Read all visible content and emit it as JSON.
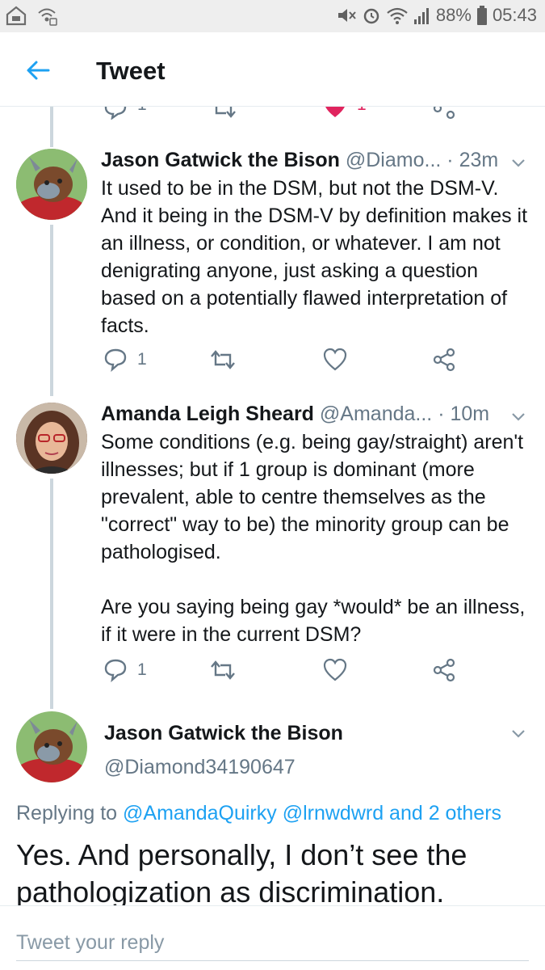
{
  "status_bar": {
    "battery": "88%",
    "time": "05:43"
  },
  "header": {
    "title": "Tweet"
  },
  "colors": {
    "accent": "#1da1f2",
    "secondary_text": "#657786",
    "primary_text": "#14171a",
    "like_red": "#e0245e"
  },
  "partial_row": {
    "reply_count": "1",
    "like_count": "1"
  },
  "tweets": [
    {
      "name": "Jason Gatwick the Bison",
      "handle": "@Diamo...",
      "time": "· 23m",
      "paragraphs": [
        "It used to be in the DSM, but not the DSM-V. And it being in the DSM-V by definition makes it an illness, or condition, or whatever. I am not denigrating anyone, just asking a question based on a potentially flawed interpretation of facts."
      ],
      "reply_count": "1"
    },
    {
      "name": "Amanda Leigh Sheard",
      "handle": "@Amanda...",
      "time": "· 10m",
      "paragraphs": [
        "Some conditions (e.g. being gay/straight) aren't illnesses; but if 1 group is dominant (more prevalent, able to centre themselves as the \"correct\" way to be) the minority group can be pathologised.",
        "Are you saying being gay *would* be an illness, if it were in the current DSM?"
      ],
      "reply_count": "1"
    }
  ],
  "main_tweet": {
    "name": "Jason Gatwick the Bison",
    "handle": "@Diamond34190647",
    "replying_prefix": "Replying to",
    "replying_users": "@AmandaQuirky @lrnwdwrd and 2 others",
    "text": "Yes. And personally, I don’t see the pathologization as discrimination."
  },
  "reply_bar": {
    "placeholder": "Tweet your reply"
  }
}
